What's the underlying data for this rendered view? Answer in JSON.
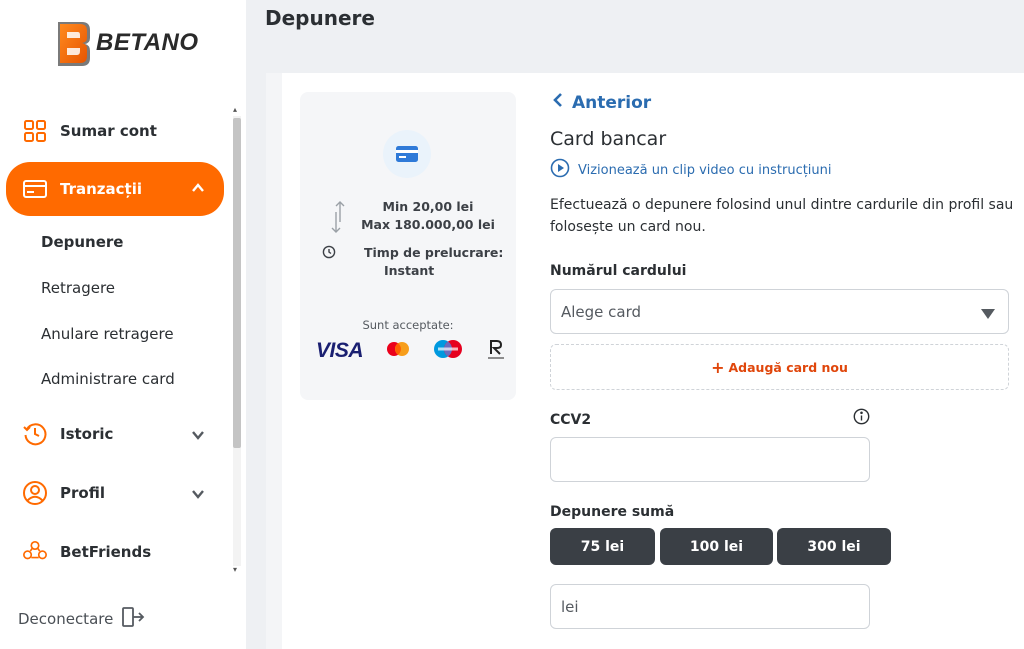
{
  "brand": {
    "name": "BETANO",
    "accent": "#ff6a00"
  },
  "sidebar": {
    "items": [
      {
        "label": "Sumar cont",
        "icon": "grid-icon"
      },
      {
        "label": "Tranzacții",
        "icon": "credit-card-icon",
        "active": true,
        "expanded": true
      },
      {
        "label": "Istoric",
        "icon": "history-icon"
      },
      {
        "label": "Profil",
        "icon": "user-icon"
      },
      {
        "label": "BetFriends",
        "icon": "friends-icon"
      }
    ],
    "sub_items": [
      "Depunere",
      "Retragere",
      "Anulare retragere",
      "Administrare card"
    ],
    "logout_label": "Deconectare"
  },
  "header": {
    "title": "Depunere"
  },
  "info_card": {
    "min": "Min 20,00 lei",
    "max": "Max 180.000,00 lei",
    "processing_label": "Timp de prelucrare:",
    "processing_value": "Instant",
    "accepted_label": "Sunt acceptate:",
    "accepted_cards": [
      "VISA",
      "Mastercard",
      "Maestro",
      "Revolut"
    ]
  },
  "form": {
    "back_label": "Anterior",
    "title": "Card bancar",
    "video_link": "Vizionează un clip video cu instrucțiuni",
    "description": "Efectuează o depunere folosind unul dintre cardurile din profil sau folosește un card nou.",
    "card_number_label": "Numărul cardului",
    "card_select_placeholder": "Alege card",
    "add_card_label": "Adaugă card nou",
    "ccv_label": "CCV2",
    "ccv_value": "",
    "amount_label": "Depunere sumă",
    "amount_options": [
      "75 lei",
      "100 lei",
      "300 lei"
    ],
    "amount_value": "lei"
  }
}
